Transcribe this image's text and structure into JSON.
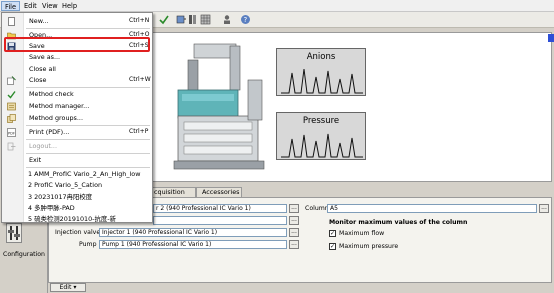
{
  "menubar": {
    "items": [
      "File",
      "Edit",
      "View",
      "Help"
    ]
  },
  "accent": {
    "highlight": "#e02020",
    "selection": "#cfe0f5"
  },
  "workspace": {
    "signals": [
      "Anions",
      "Pressure"
    ]
  },
  "tabs": [
    "cquisition",
    "Accessories"
  ],
  "panel": {
    "row1_value": "r 2 (940 Professional IC Vario 1)",
    "column_label": "Column",
    "column_value": "A5",
    "monitor_heading": "Monitor maximum values of the column",
    "injection_label": "Injection valve",
    "injection_value": "Injector 1 (940 Professional IC Vario 1)",
    "pump_label": "Pump",
    "pump_value": "Pump 1 (940 Professional IC Vario 1)",
    "max_flow_label": "Maximum flow",
    "max_pressure_label": "Maximum pressure",
    "dots": "..."
  },
  "leftstrip": {
    "label": "Configuration"
  },
  "bottom": {
    "edit_label": "Edit"
  },
  "file_menu": {
    "new": {
      "label": "New...",
      "shortcut": "Ctrl+N"
    },
    "open": {
      "label": "Open...",
      "shortcut": "Ctrl+O"
    },
    "save": {
      "label": "Save",
      "shortcut": "Ctrl+S"
    },
    "save_as": {
      "label": "Save as..."
    },
    "close_all": {
      "label": "Close all"
    },
    "close": {
      "label": "Close",
      "shortcut": "Ctrl+W"
    },
    "method_check": {
      "label": "Method check"
    },
    "method_manager": {
      "label": "Method manager..."
    },
    "method_groups": {
      "label": "Method groups..."
    },
    "print": {
      "label": "Print (PDF)...",
      "shortcut": "Ctrl+P"
    },
    "logout": {
      "label": "Logout..."
    },
    "exit": {
      "label": "Exit"
    },
    "recent": [
      "1 AMM_ProfIC Vario_2_An_High_low",
      "2 ProfIC Vario_5_Cation",
      "3 20231017冉阳校度",
      "4 多肿甲脉-PAD",
      "5 硫类检测20191010-抗度-新"
    ]
  }
}
